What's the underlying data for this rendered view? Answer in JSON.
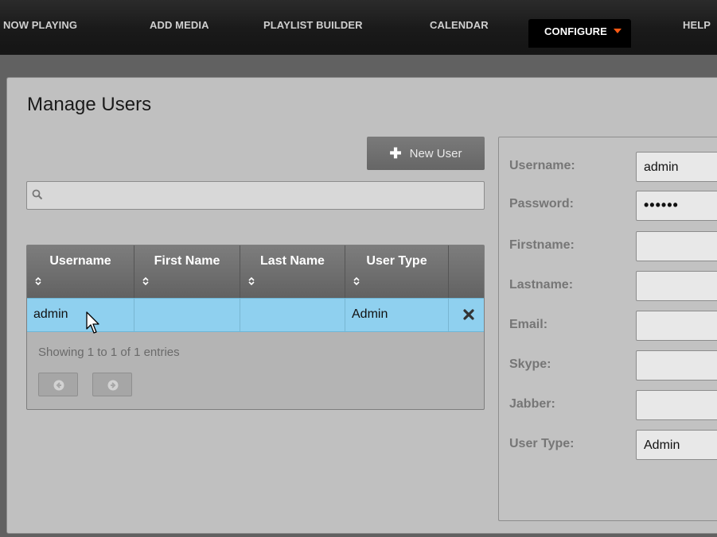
{
  "nav": {
    "items": [
      {
        "label": "NOW PLAYING"
      },
      {
        "label": "ADD MEDIA"
      },
      {
        "label": "PLAYLIST BUILDER"
      },
      {
        "label": "CALENDAR"
      },
      {
        "label": "CONFIGURE"
      },
      {
        "label": "HELP"
      }
    ],
    "active_index": 4,
    "accent_color": "#ff5a14"
  },
  "page": {
    "title": "Manage Users",
    "new_user_label": "New User",
    "search": {
      "value": "",
      "placeholder": ""
    }
  },
  "table": {
    "columns": [
      "Username",
      "First Name",
      "Last Name",
      "User Type",
      ""
    ],
    "rows": [
      {
        "username": "admin",
        "first_name": "",
        "last_name": "",
        "user_type": "Admin",
        "selected": true
      }
    ],
    "entries_info": "Showing 1 to 1 of 1 entries",
    "selected_row_color": "#8fd0ef"
  },
  "form": {
    "fields": [
      {
        "label": "Username:",
        "value": "admin"
      },
      {
        "label": "Password:",
        "value": "••••••"
      },
      {
        "label": "Firstname:",
        "value": ""
      },
      {
        "label": "Lastname:",
        "value": ""
      },
      {
        "label": "Email:",
        "value": ""
      },
      {
        "label": "Skype:",
        "value": ""
      },
      {
        "label": "Jabber:",
        "value": ""
      },
      {
        "label": "User Type:",
        "value": "Admin"
      }
    ]
  },
  "icons": [
    "search-icon",
    "plus-icon",
    "sort-icon",
    "delete-icon",
    "prev-arrow-icon",
    "next-arrow-icon",
    "mouse-cursor-icon",
    "dropdown-caret-icon"
  ]
}
